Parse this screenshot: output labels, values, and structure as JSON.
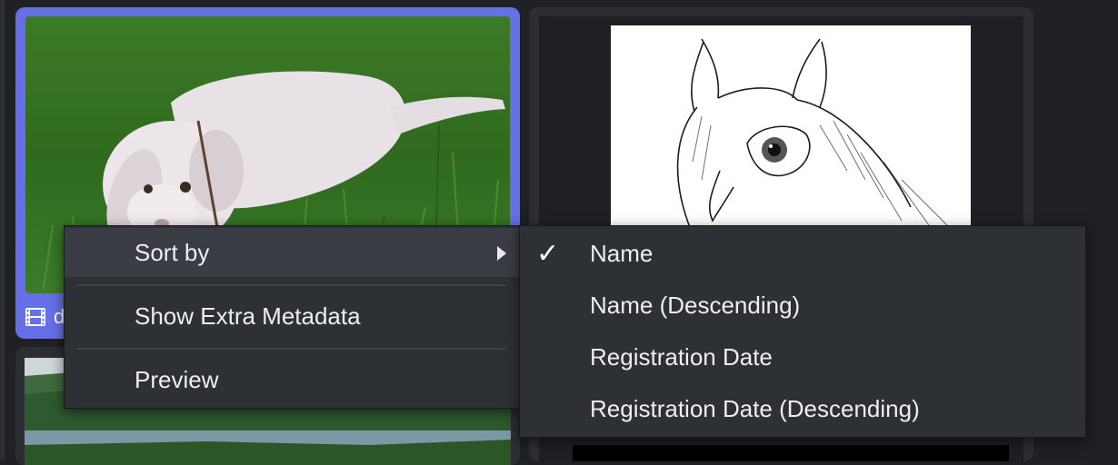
{
  "gallery": {
    "cards": [
      {
        "caption": "d",
        "media_type_icon": "film-icon",
        "selected": true,
        "accent_color": "#6670e6"
      },
      {
        "caption": "",
        "media_type_icon": "",
        "selected": false
      },
      {
        "caption": "",
        "media_type_icon": "",
        "selected": false
      }
    ]
  },
  "context_menu": {
    "items": [
      {
        "label": "Sort by",
        "has_submenu": true,
        "submenu_icon": "chevron-right-icon"
      },
      {
        "label": "Show Extra Metadata"
      },
      {
        "label": "Preview"
      }
    ]
  },
  "sort_submenu": {
    "checked_glyph": "✓",
    "items": [
      {
        "label": "Name",
        "checked": true
      },
      {
        "label": "Name (Descending)",
        "checked": false
      },
      {
        "label": "Registration Date",
        "checked": false
      },
      {
        "label": "Registration Date (Descending)",
        "checked": false
      }
    ]
  },
  "colors": {
    "background": "#1f2125",
    "card": "#2b2e33",
    "selected_card": "#6670e6",
    "menu": "#2d3035",
    "menu_highlight": "#3a3d43"
  }
}
